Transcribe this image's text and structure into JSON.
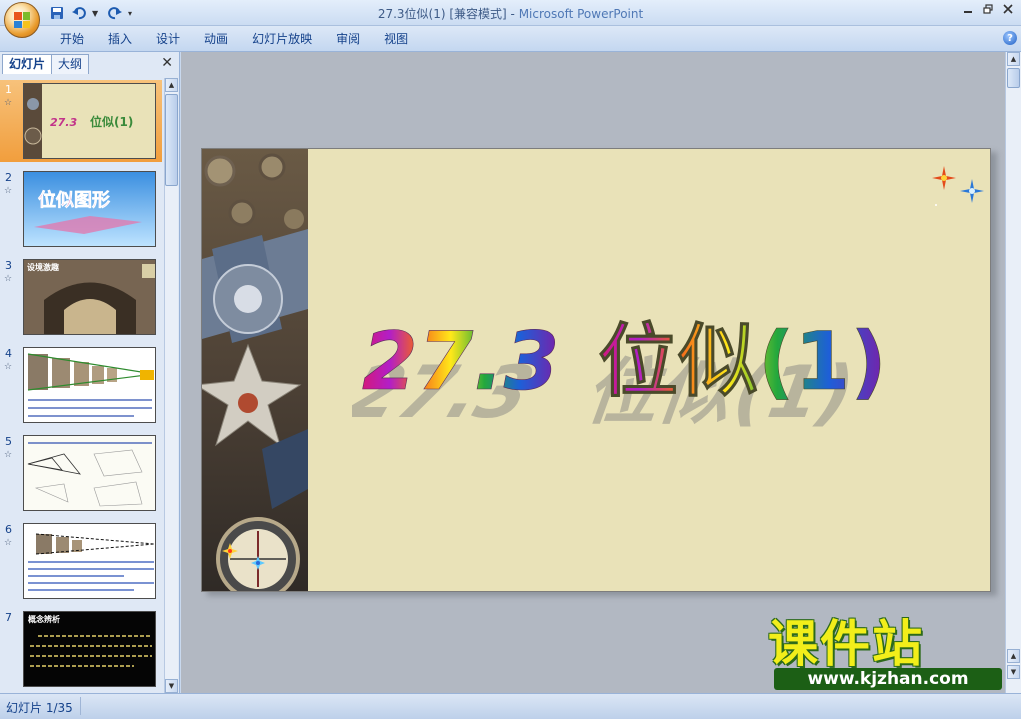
{
  "window": {
    "title": "27.3位似(1) [兼容模式]",
    "separator": " - ",
    "app_name": "Microsoft PowerPoint"
  },
  "quick_access": {
    "save_icon": "save-icon",
    "undo_icon": "undo-icon",
    "redo_icon": "redo-icon",
    "customize_icon": "customize-icon"
  },
  "ribbon": {
    "tabs": [
      "开始",
      "插入",
      "设计",
      "动画",
      "幻灯片放映",
      "审阅",
      "视图"
    ]
  },
  "left_pane": {
    "tab_slides": "幻灯片",
    "tab_outline": "大纲",
    "close": "✕",
    "slides": [
      {
        "num": "1",
        "label": "27.3位似(1)"
      },
      {
        "num": "2",
        "label": "位似图形"
      },
      {
        "num": "3",
        "label": "设境激趣"
      },
      {
        "num": "4",
        "label": ""
      },
      {
        "num": "5",
        "label": ""
      },
      {
        "num": "6",
        "label": ""
      },
      {
        "num": "7",
        "label": "概念辨析"
      }
    ],
    "slide7_text": "若两个图形相似，且各组对应点所在直线都经过同一个点，那么这样的两个图形叫做位似图形，这个点叫做位似中心。",
    "slide6_text": "如果两个图形不仅是相似图形，而且每组对应点所在直线都经过同一个点，那么这样的两个图形叫做位似图形。"
  },
  "slide": {
    "title_number": "27.3",
    "title_text": "位似(1)"
  },
  "watermark": {
    "logo": "课件站",
    "url": "www.kjzhan.com"
  },
  "status": {
    "slide_indicator": "幻灯片 1/35"
  },
  "colors": {
    "selected_thumb": "#f19e3d",
    "slide_bg": "#e9e2b8",
    "watermark_yellow": "#f2ee1a",
    "watermark_green": "#1c5f15"
  }
}
